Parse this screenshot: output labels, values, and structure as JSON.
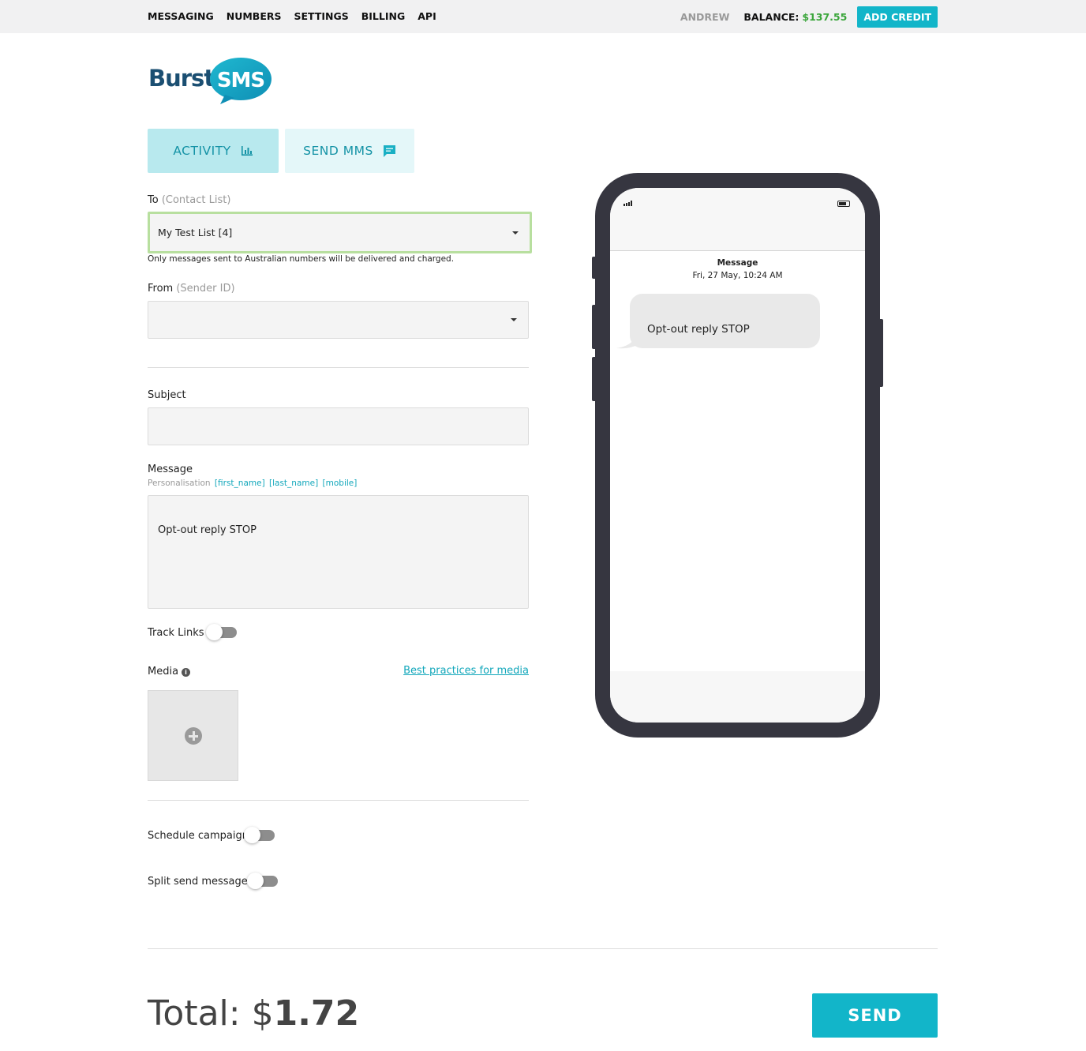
{
  "nav": {
    "messaging": "MESSAGING",
    "numbers": "NUMBERS",
    "settings": "SETTINGS",
    "billing": "BILLING",
    "api": "API",
    "user": "ANDREW",
    "balance_label": "BALANCE:",
    "balance_value": "$137.55",
    "add_credit": "ADD CREDIT"
  },
  "logo": {
    "part1": "Burst",
    "part2": "SMS"
  },
  "tabs": [
    {
      "label": "ACTIVITY",
      "icon": "bar-chart-icon",
      "active": true
    },
    {
      "label": "SEND MMS",
      "icon": "chat-icon",
      "active": false
    }
  ],
  "form": {
    "to_label": "To",
    "to_hint": "(Contact List)",
    "to_value": "My Test List [4]",
    "to_note": "Only messages sent to Australian numbers will be delivered and charged.",
    "from_label": "From",
    "from_hint": "(Sender ID)",
    "from_value": "",
    "subject_label": "Subject",
    "subject_value": "",
    "message_label": "Message",
    "personalisation_label": "Personalisation",
    "personalisation_tags": [
      "[first_name]",
      "[last_name]",
      "[mobile]"
    ],
    "message_value": "Opt-out reply STOP",
    "track_links_label": "Track Links",
    "track_links_on": false,
    "media_label": "Media",
    "media_link": "Best practices for media",
    "schedule_label": "Schedule campaign",
    "schedule_on": false,
    "split_label": "Split send messages",
    "split_on": false
  },
  "preview": {
    "title": "Message",
    "timestamp": "Fri, 27 May, 10:24 AM",
    "bubble_text": "Opt-out reply STOP"
  },
  "footer": {
    "total_label": "Total: $",
    "total_value": "1.72",
    "send_label": "SEND"
  },
  "colors": {
    "accent": "#12b5c9",
    "balance": "#3aa53a",
    "tab_active_bg": "#b8e9ee",
    "tab_bg": "#e4f7f9",
    "phone_frame": "#363640",
    "focus_border": "#b8df9f"
  }
}
